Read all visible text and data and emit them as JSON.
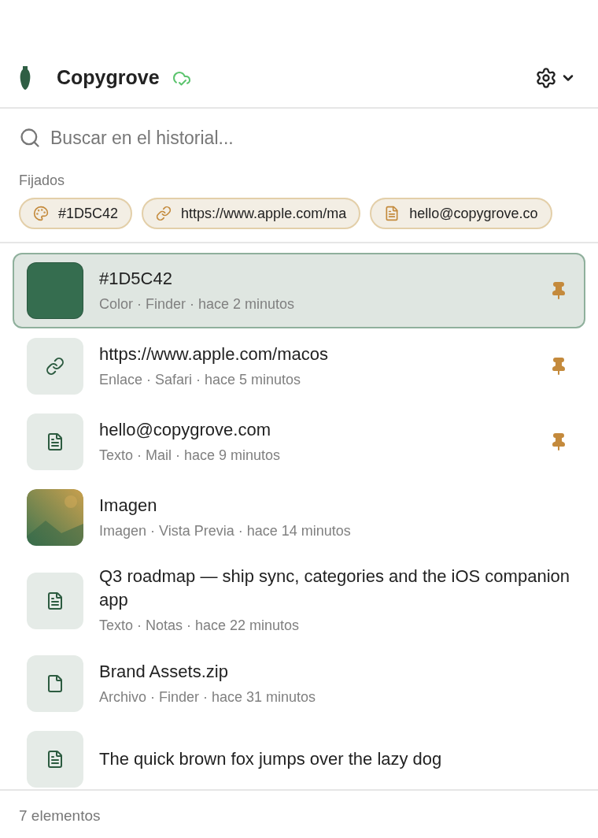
{
  "app": {
    "title": "Copygrove",
    "synced": true
  },
  "search": {
    "placeholder": "Buscar en el historial..."
  },
  "pinned": {
    "label": "Fijados",
    "chips": [
      {
        "kind": "color",
        "text": "#1D5C42"
      },
      {
        "kind": "link",
        "text": "https://www.apple.com/ma"
      },
      {
        "kind": "text",
        "text": "hello@copygrove.co"
      }
    ]
  },
  "items": [
    {
      "kind": "color",
      "color": "#356d4f",
      "title": "#1D5C42",
      "meta": "Color · Finder · hace 2 minutos",
      "pinned": true,
      "selected": true
    },
    {
      "kind": "link",
      "title": "https://www.apple.com/macos",
      "meta": "Enlace · Safari · hace 5 minutos",
      "pinned": true,
      "selected": false
    },
    {
      "kind": "text",
      "title": "hello@copygrove.com",
      "meta": "Texto · Mail · hace 9 minutos",
      "pinned": true,
      "selected": false
    },
    {
      "title": "Imagen",
      "meta": "Imagen · Vista Previa · hace 14 minutos",
      "pinned": false,
      "selected": false
    },
    {
      "kind": "text",
      "title": "Q3 roadmap — ship sync, categories and the iOS companion app",
      "meta": "Texto · Notas · hace 22 minutos",
      "pinned": false,
      "selected": false
    },
    {
      "kind": "file",
      "title": "Brand Assets.zip",
      "meta": "Archivo · Finder · hace 31 minutos",
      "pinned": false,
      "selected": false
    },
    {
      "kind": "text",
      "title": "The quick brown fox jumps over the lazy dog",
      "pinned": false,
      "selected": false
    }
  ],
  "status_bar": "7 elementos"
}
